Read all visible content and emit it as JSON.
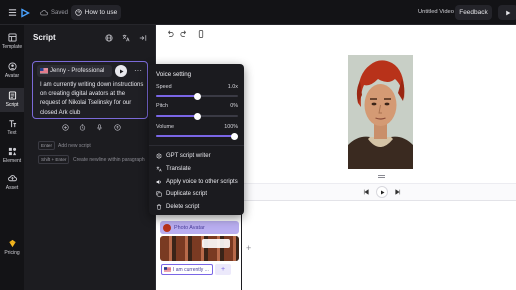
{
  "topbar": {
    "saved_label": "Saved",
    "how_to_use": "How to use",
    "project_title": "Untitled Video",
    "feedback": "Feedback"
  },
  "sidebar": {
    "items": [
      {
        "label": "Template",
        "icon": "template-icon"
      },
      {
        "label": "Avatar",
        "icon": "avatar-icon"
      },
      {
        "label": "Script",
        "icon": "script-icon"
      },
      {
        "label": "Text",
        "icon": "text-icon"
      },
      {
        "label": "Element",
        "icon": "element-icon"
      },
      {
        "label": "Asset",
        "icon": "asset-icon"
      },
      {
        "label": "Pricing",
        "icon": "pricing-icon"
      }
    ]
  },
  "script_panel": {
    "title": "Script",
    "voice_name": "Jenny - Professional",
    "text": "I am currently writing down instructions on creating digital avators at the request of Nikolai Tselinsky for our closed Ark club",
    "enter_key": "Enter",
    "enter_hint": "Add new script",
    "shift_enter_key": "Shift + Enter",
    "shift_enter_hint": "Create newline within paragraph"
  },
  "voice_menu": {
    "title": "Voice setting",
    "speed_label": "Speed",
    "speed_value": "1.0x",
    "speed_fraction": 0.5,
    "pitch_label": "Pitch",
    "pitch_value": "0%",
    "pitch_fraction": 0.5,
    "volume_label": "Volume",
    "volume_value": "100%",
    "volume_fraction": 1.0,
    "items": [
      "GPT script writer",
      "Translate",
      "Apply voice to other scripts",
      "Duplicate script",
      "Delete script"
    ]
  },
  "timeline": {
    "photo_avatar_label": "Photo Avatar",
    "script_chip": "I am currently ..."
  },
  "colors": {
    "accent": "#7a66e6",
    "dark_bg": "#1a1a1d",
    "canvas_bg": "#ffffff"
  }
}
